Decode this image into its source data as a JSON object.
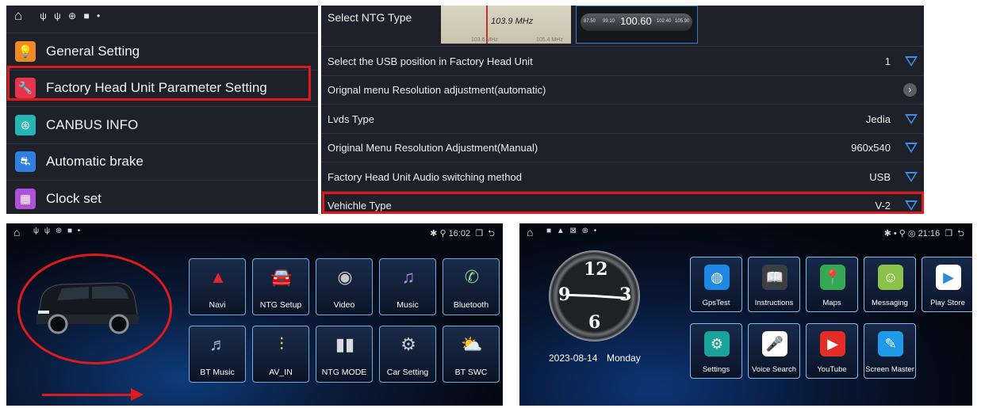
{
  "settings_menu": {
    "items": [
      {
        "label": "General Setting",
        "icon": "lightbulb-icon",
        "color": "#f08a24",
        "glyph": "💡"
      },
      {
        "label": "Factory Head Unit Parameter Setting",
        "icon": "wrench-icon",
        "color": "#e8344c",
        "glyph": "🔧"
      },
      {
        "label": "CANBUS INFO",
        "icon": "canbus-icon",
        "color": "#27b6b8",
        "glyph": "⊛"
      },
      {
        "label": "Automatic brake",
        "icon": "brake-icon",
        "color": "#2f7fe0",
        "glyph": "⛐"
      },
      {
        "label": "Clock set",
        "icon": "calendar-icon",
        "color": "#b04fd8",
        "glyph": "▦"
      }
    ]
  },
  "param_panel": {
    "ntg_label": "Select NTG Type",
    "radio1_freq": "103.9 MHz",
    "radio1_scale_left": "103.6 MHz",
    "radio1_scale_right": "105.4 MHz",
    "radio2_freq": "100.60",
    "radio2_ticks": [
      "87.50",
      "99.10",
      "102.40",
      "105.90"
    ],
    "rows": [
      {
        "label": "Select the USB position in Factory Head Unit",
        "value": "1",
        "control": "dropdown"
      },
      {
        "label": "Orignal menu Resolution adjustment(automatic)",
        "value": "",
        "control": "chevron"
      },
      {
        "label": "Lvds Type",
        "value": "Jedia",
        "control": "dropdown"
      },
      {
        "label": "Original Menu Resolution Adjustment(Manual)",
        "value": "960x540",
        "control": "dropdown"
      },
      {
        "label": "Factory Head Unit Audio switching method",
        "value": "USB",
        "control": "dropdown"
      },
      {
        "label": "Vehichle Type",
        "value": "V-2",
        "control": "dropdown"
      }
    ]
  },
  "home1": {
    "time": "16:02",
    "tiles": [
      {
        "label": "Navi",
        "icon": "navi-icon",
        "glyph": "▲",
        "color": "#e0262b"
      },
      {
        "label": "NTG Setup",
        "icon": "car-icon",
        "glyph": "🚘",
        "color": "#cfd3d8"
      },
      {
        "label": "Video",
        "icon": "video-icon",
        "glyph": "◉",
        "color": "#c8c8c8"
      },
      {
        "label": "Music",
        "icon": "music-icon",
        "glyph": "♫",
        "color": "#b98ce0"
      },
      {
        "label": "Bluetooth",
        "icon": "phone-icon",
        "glyph": "✆",
        "color": "#8fd08f"
      },
      {
        "label": "BT Music",
        "icon": "bt-music-icon",
        "glyph": "♬",
        "color": "#9cc0e8"
      },
      {
        "label": "AV_IN",
        "icon": "av-in-icon",
        "glyph": "⫶",
        "color": "#e8d040"
      },
      {
        "label": "NTG MODE",
        "icon": "ntg-mode-icon",
        "glyph": "▮▮",
        "color": "#d7dbe0"
      },
      {
        "label": "Car Setting",
        "icon": "gear-icon",
        "glyph": "⚙",
        "color": "#c8ccd2"
      },
      {
        "label": "BT SWC",
        "icon": "weather-icon",
        "glyph": "⛅",
        "color": "#f2c94c"
      }
    ]
  },
  "home2": {
    "time": "21:16",
    "date": "2023-08-14",
    "day": "Monday",
    "clock_numerals": [
      "12",
      "3",
      "6",
      "9"
    ],
    "tiles": [
      {
        "label": "GpsTest",
        "icon": "globe-icon",
        "glyph": "◍",
        "color": "#1e88e5"
      },
      {
        "label": "Instructions",
        "icon": "book-icon",
        "glyph": "📖",
        "color": "#3a3f46"
      },
      {
        "label": "Maps",
        "icon": "maps-icon",
        "glyph": "📍",
        "color": "#34a853"
      },
      {
        "label": "Messaging",
        "icon": "messaging-icon",
        "glyph": "☺",
        "color": "#8bc34a"
      },
      {
        "label": "Play Store",
        "icon": "play-store-icon",
        "glyph": "▶",
        "color": "#ffffff"
      },
      {
        "label": "Settings",
        "icon": "settings-icon",
        "glyph": "⚙",
        "color": "#1aa39a"
      },
      {
        "label": "Voice Search",
        "icon": "mic-icon",
        "glyph": "🎤",
        "color": "#ffffff"
      },
      {
        "label": "YouTube",
        "icon": "youtube-icon",
        "glyph": "▶",
        "color": "#e52d27"
      },
      {
        "label": "Screen Master",
        "icon": "screen-master-icon",
        "glyph": "✎",
        "color": "#1e9be8"
      }
    ]
  }
}
